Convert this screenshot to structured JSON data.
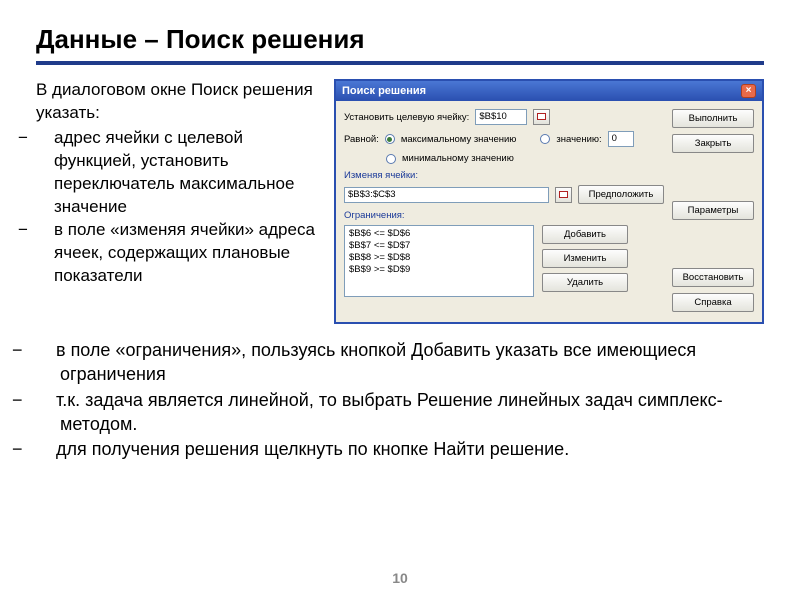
{
  "slide": {
    "title": "Данные – Поиск решения",
    "page_number": "10"
  },
  "left_text": {
    "intro": "В диалоговом окне Поиск решения указать:",
    "items": [
      "адрес ячейки с целевой функцией, установить переключатель максимальное значение",
      "в поле «изменяя ячейки» адреса ячеек, содержащих плановые показатели"
    ]
  },
  "dialog": {
    "title": "Поиск решения",
    "target_label": "Установить целевую ячейку:",
    "target_value": "$B$10",
    "equal_label": "Равной:",
    "radio_max": "максимальному значению",
    "radio_value": "значению:",
    "radio_min": "минимальному значению",
    "value_input": "0",
    "changing_label": "Изменяя ячейки:",
    "changing_value": "$B$3:$C$3",
    "constraints_label": "Ограничения:",
    "constraints": [
      "$B$6 <= $D$6",
      "$B$7 <= $D$7",
      "$B$8 >= $D$8",
      "$B$9 >= $D$9"
    ],
    "btn_guess": "Предположить",
    "btn_add": "Добавить",
    "btn_change": "Изменить",
    "btn_delete": "Удалить",
    "btn_run": "Выполнить",
    "btn_close": "Закрыть",
    "btn_params": "Параметры",
    "btn_restore": "Восстановить",
    "btn_help": "Справка"
  },
  "lower_text": {
    "items": [
      "в поле «ограничения», пользуясь кнопкой Добавить указать все имеющиеся ограничения",
      "т.к. задача является линейной, то выбрать Решение линейных задач симплекс-методом.",
      "для получения решения щелкнуть по кнопке Найти решение."
    ]
  }
}
